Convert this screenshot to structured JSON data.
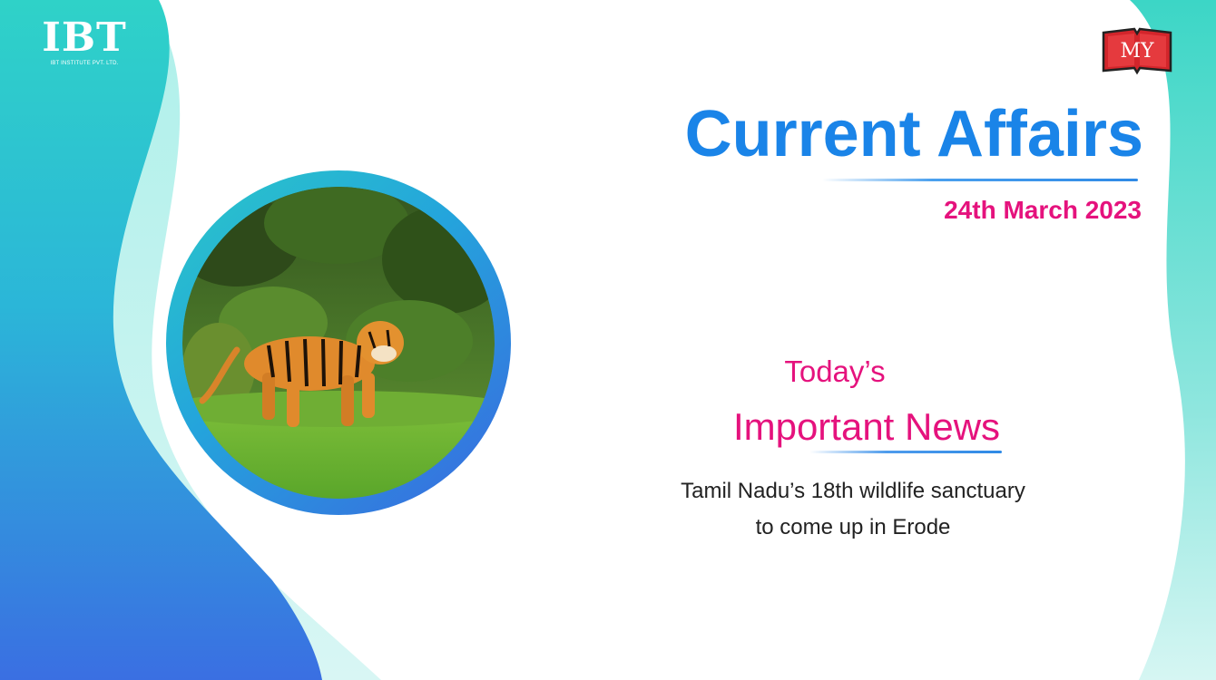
{
  "brand": {
    "logo_text": "IBT",
    "logo_subtext": "IBT INSTITUTE PVT. LTD.",
    "badge_text": "MY"
  },
  "header": {
    "title": "Current Affairs",
    "date": "24th March 2023"
  },
  "news": {
    "heading_line1": "Today’s",
    "heading_line2": "Important News",
    "headline_line1": "Tamil Nadu’s 18th wildlife sanctuary",
    "headline_line2": "to come up in Erode"
  },
  "image": {
    "subject": "tiger-in-forest"
  },
  "colors": {
    "title_blue": "#1a84e8",
    "accent_pink": "#e5127d",
    "text_dark": "#222222",
    "wave_teal": "#2ad3c6",
    "wave_blue": "#3a6fe2",
    "badge_red": "#d3252b"
  }
}
